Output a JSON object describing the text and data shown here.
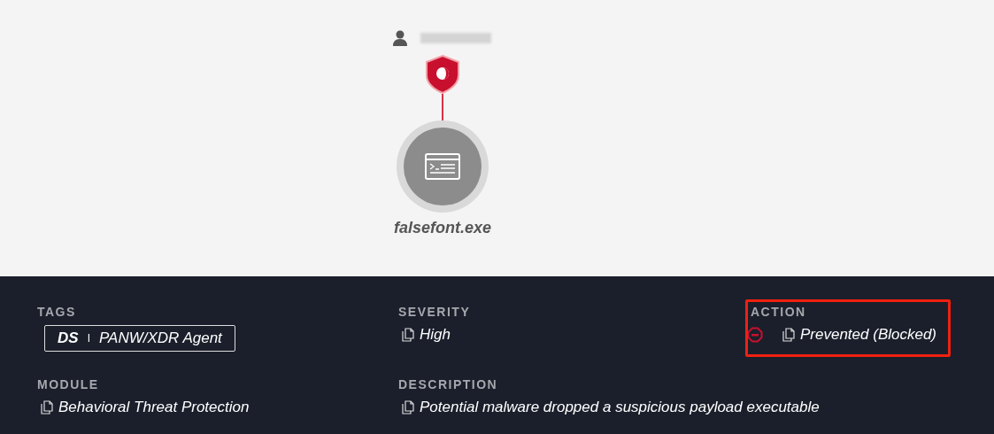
{
  "graph": {
    "process": {
      "label": "falsefont.exe"
    }
  },
  "fields": [
    {
      "label": "TAGS",
      "kind": "tag",
      "tag_key": "DS",
      "separator": "I",
      "tag_value": "PANW/XDR Agent",
      "highlighted": false
    },
    {
      "label": "SEVERITY",
      "kind": "text",
      "value": "High",
      "blocked": false,
      "highlighted": false
    },
    {
      "label": "ACTION",
      "kind": "text",
      "value": "Prevented (Blocked)",
      "blocked": true,
      "highlighted": true
    },
    {
      "label": "MODULE",
      "kind": "text",
      "value": "Behavioral Threat Protection",
      "blocked": false,
      "highlighted": false
    },
    {
      "label": "DESCRIPTION",
      "kind": "text",
      "value": "Potential malware dropped a suspicious payload executable",
      "blocked": false,
      "highlighted": false
    }
  ]
}
